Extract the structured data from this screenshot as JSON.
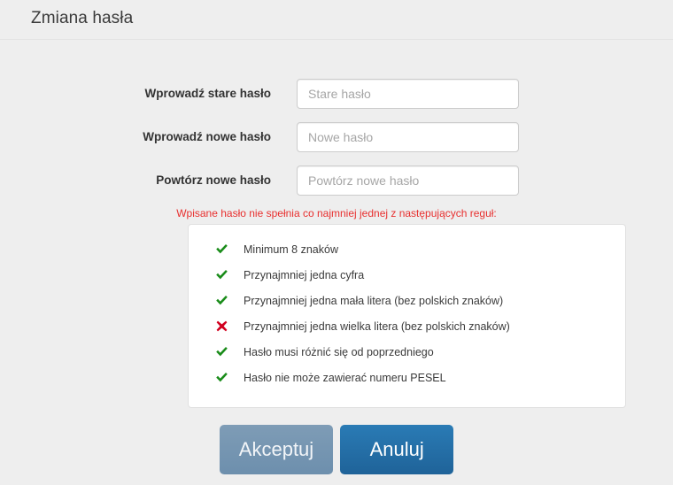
{
  "header": {
    "title": "Zmiana hasła"
  },
  "form": {
    "fields": [
      {
        "label": "Wprowadź stare hasło",
        "placeholder": "Stare hasło",
        "value": ""
      },
      {
        "label": "Wprowadź nowe hasło",
        "placeholder": "Nowe hasło",
        "value": ""
      },
      {
        "label": "Powtórz nowe hasło",
        "placeholder": "Powtórz nowe hasło",
        "value": ""
      }
    ]
  },
  "validation": {
    "error_message": "Wpisane hasło nie spełnia co najmniej jednej z następujących reguł:",
    "error_color": "#e8302f",
    "pass_color": "#1a8c1a",
    "fail_color": "#d1001f",
    "rules": [
      {
        "text": "Minimum 8 znaków",
        "status": "pass",
        "icon": "check-icon"
      },
      {
        "text": "Przynajmniej jedna cyfra",
        "status": "pass",
        "icon": "check-icon"
      },
      {
        "text": "Przynajmniej jedna mała litera (bez polskich znaków)",
        "status": "pass",
        "icon": "check-icon"
      },
      {
        "text": "Przynajmniej jedna wielka litera (bez polskich znaków)",
        "status": "fail",
        "icon": "cross-icon"
      },
      {
        "text": "Hasło musi różnić się od poprzedniego",
        "status": "pass",
        "icon": "check-icon"
      },
      {
        "text": "Hasło nie może zawierać numeru PESEL",
        "status": "pass",
        "icon": "check-icon"
      }
    ]
  },
  "buttons": {
    "accept_label": "Akceptuj",
    "cancel_label": "Anuluj",
    "accept_color": "#6d8fad",
    "cancel_color": "#1f6399"
  }
}
